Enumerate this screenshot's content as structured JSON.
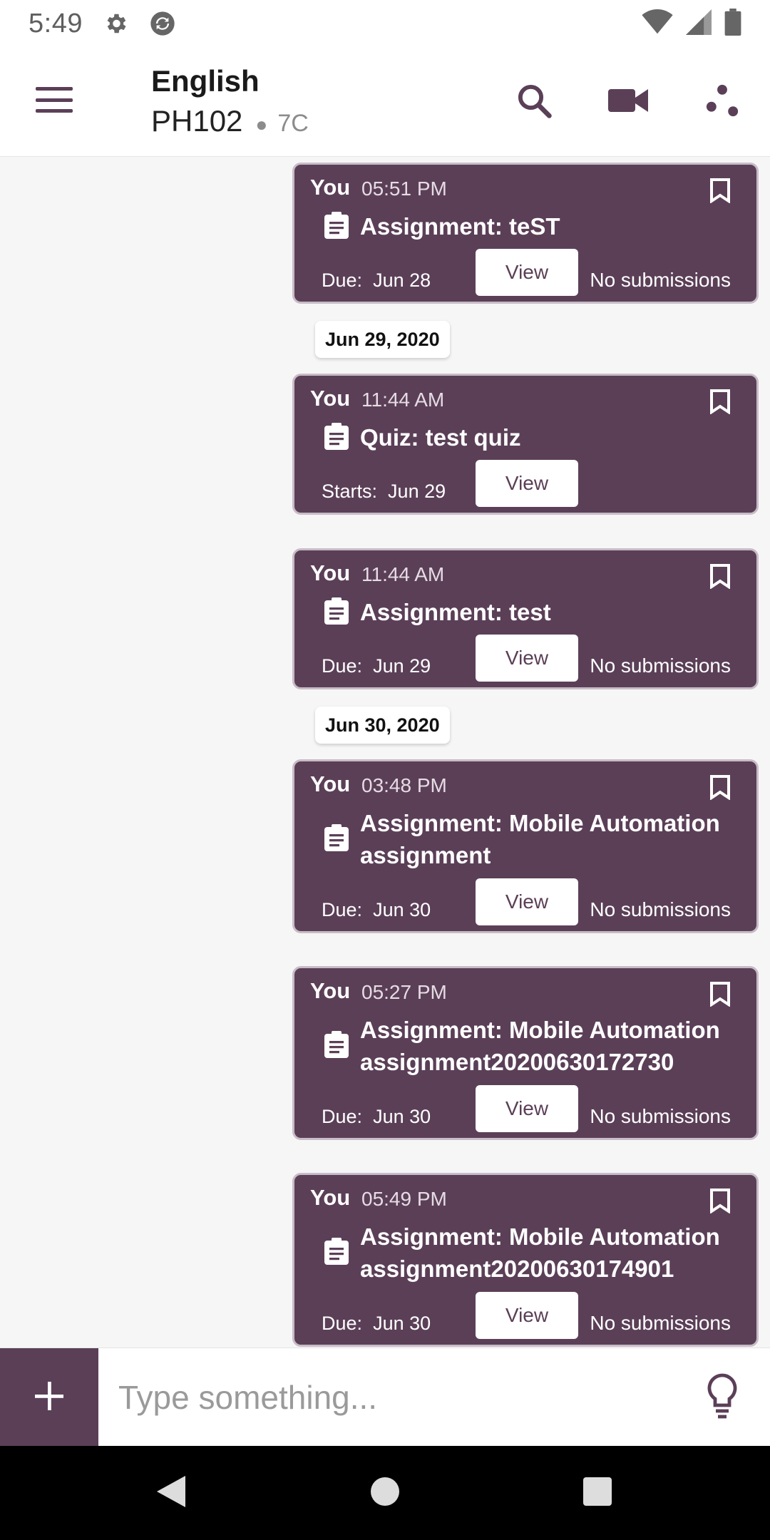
{
  "status_bar": {
    "time": "5:49"
  },
  "app_bar": {
    "title": "English",
    "subtitle": "PH102",
    "section": "7C"
  },
  "labels": {
    "sender": "You",
    "view": "View",
    "no_submissions": "No submissions"
  },
  "messages": [
    {
      "time": "05:51 PM",
      "title": "Assignment: teST",
      "meta_label": "Due:",
      "meta_date": "Jun 28",
      "show_submissions": true
    },
    {
      "time": "11:44 AM",
      "title": "Quiz: test quiz",
      "meta_label": "Starts:",
      "meta_date": "Jun 29",
      "show_submissions": false
    },
    {
      "time": "11:44 AM",
      "title": "Assignment: test",
      "meta_label": "Due:",
      "meta_date": "Jun 29",
      "show_submissions": true
    },
    {
      "time": "03:48 PM",
      "title": "Assignment: Mobile Automation assignment",
      "meta_label": "Due:",
      "meta_date": "Jun 30",
      "show_submissions": true
    },
    {
      "time": "05:27 PM",
      "title": "Assignment: Mobile Automation assignment20200630172730",
      "meta_label": "Due:",
      "meta_date": "Jun 30",
      "show_submissions": true
    },
    {
      "time": "05:49 PM",
      "title": "Assignment: Mobile Automation assignment20200630174901",
      "meta_label": "Due:",
      "meta_date": "Jun 30",
      "show_submissions": true
    }
  ],
  "date_chips": [
    "Jun 29, 2020",
    "Jun 30, 2020"
  ],
  "composer": {
    "placeholder": "Type something..."
  },
  "colors": {
    "accent": "#5b3f57",
    "background": "#f6f6f6"
  }
}
